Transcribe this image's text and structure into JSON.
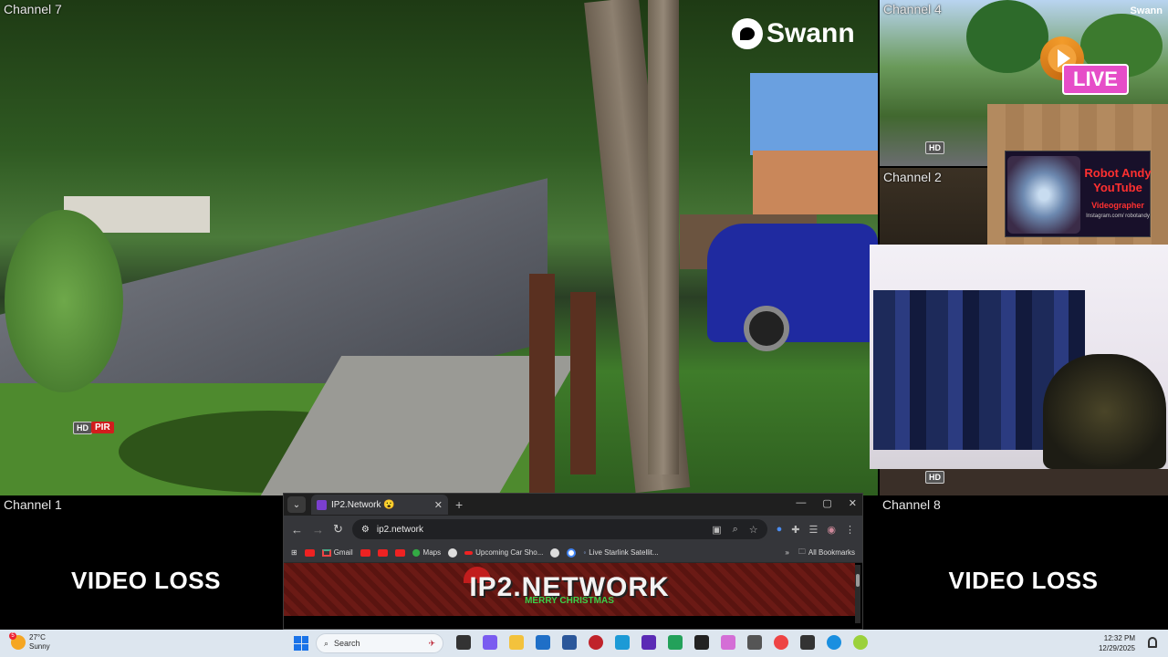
{
  "cameras": {
    "ch7": {
      "label": "Channel 7"
    },
    "ch4": {
      "label": "Channel 4",
      "brand": "Swann"
    },
    "ch2": {
      "label": "Channel 2"
    },
    "ch1": {
      "label": "Channel 1",
      "status": "VIDEO LOSS"
    },
    "ch8": {
      "label": "Channel 8",
      "status": "VIDEO LOSS"
    }
  },
  "overlay": {
    "brand": "Swann",
    "hd_badge": "HD",
    "pir_badge": "PIR",
    "live_label": "LIVE",
    "youtube_card": {
      "line1": "Robot Andy",
      "line2": "YouTube",
      "role": "Videographer",
      "handle": "Instagram.com/ robotandy"
    }
  },
  "browser": {
    "tab_title": "IP2.Network 😮",
    "url": "ip2.network",
    "bookmarks": [
      "Gmail",
      "Maps",
      "Upcoming Car Sho...",
      "Live Starlink Satellit..."
    ],
    "all_bookmarks": "All Bookmarks",
    "banner_title": "IP2.NETWORK",
    "banner_sub": "MERRY CHRISTMAS"
  },
  "taskbar": {
    "weather_temp": "27°C",
    "weather_desc": "Sunny",
    "weather_badge": "5",
    "search_placeholder": "Search",
    "time": "12:32 PM",
    "date": "12/29/2025"
  },
  "colors": {
    "accent_live": "#e64dc8",
    "pir_red": "#d21d1d",
    "taskbar_bg": "#dde6ef"
  }
}
